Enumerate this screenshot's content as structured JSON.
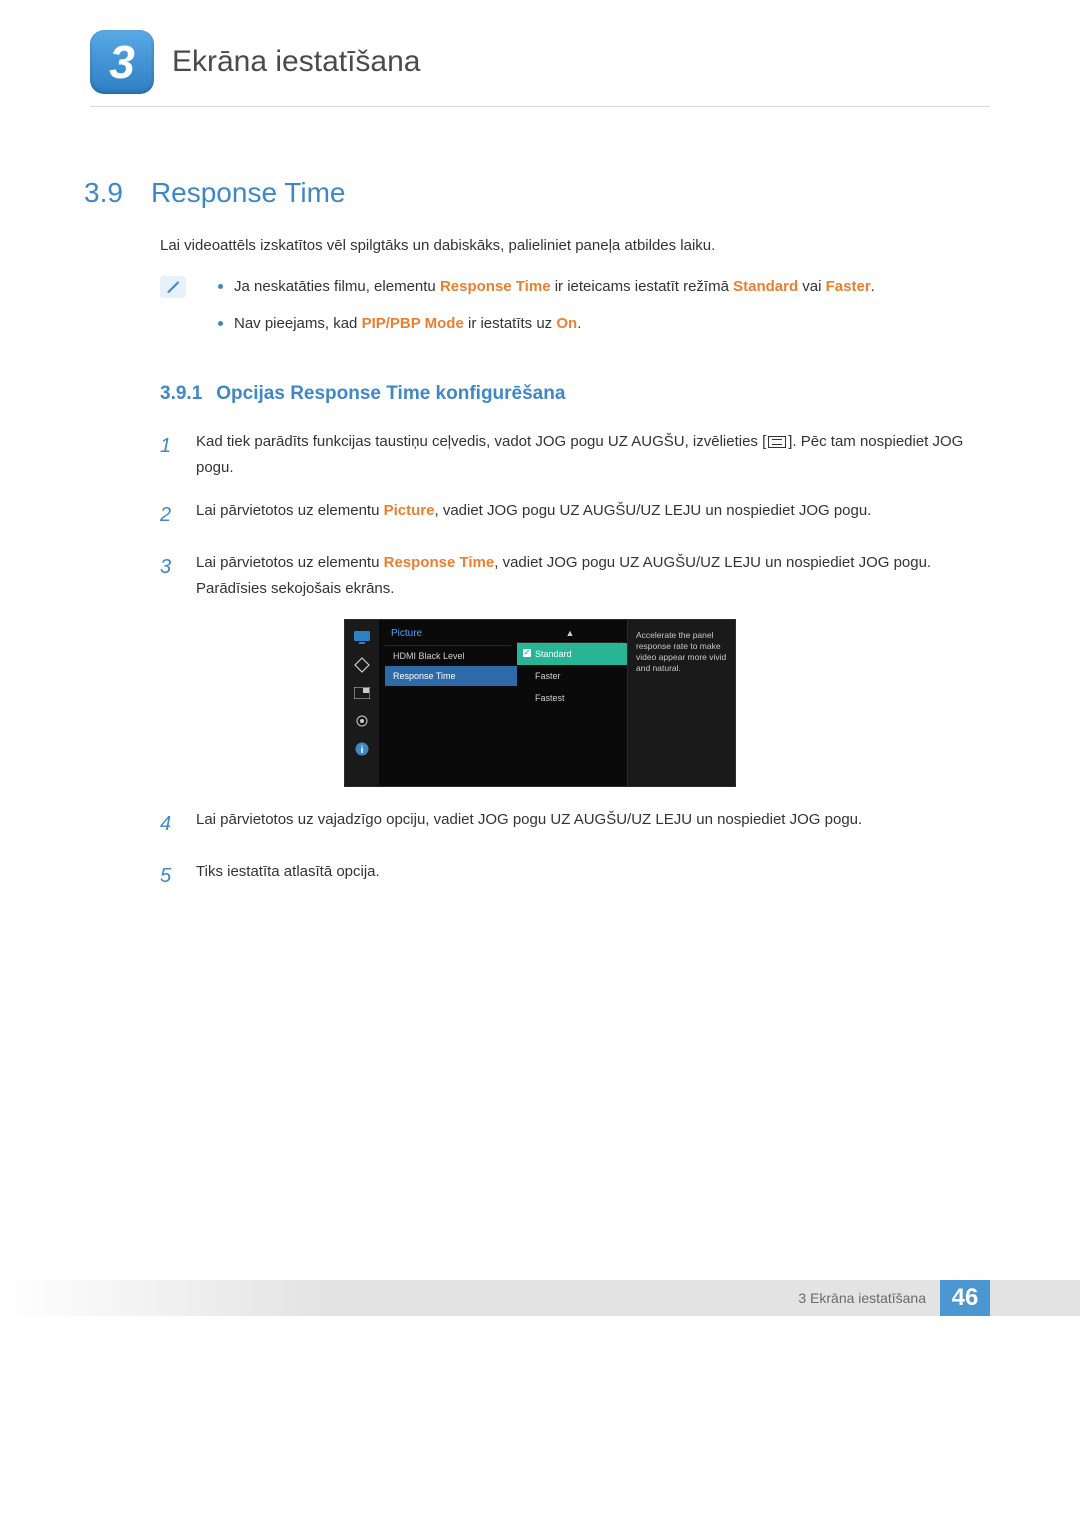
{
  "chapter": {
    "number": "3",
    "title": "Ekrāna iestatīšana"
  },
  "section": {
    "number": "3.9",
    "title": "Response Time"
  },
  "intro": "Lai videoattēls izskatītos vēl spilgtāks un dabiskāks, palieliniet paneļa atbildes laiku.",
  "notes": {
    "n1a": "Ja neskatāties filmu, elementu ",
    "n1_hl1": "Response Time",
    "n1b": " ir ieteicams iestatīt režīmā ",
    "n1_hl2": "Standard",
    "n1c": " vai ",
    "n1_hl3": "Faster",
    "n1d": ".",
    "n2a": "Nav pieejams, kad ",
    "n2_hl1": "PIP/PBP Mode",
    "n2b": " ir iestatīts uz ",
    "n2_hl2": "On",
    "n2c": "."
  },
  "subsection": {
    "number": "3.9.1",
    "title": "Opcijas Response Time konfigurēšana"
  },
  "steps": {
    "s1a": "Kad tiek parādīts funkcijas taustiņu ceļvedis, vadot JOG pogu UZ AUGŠU, izvēlieties [",
    "s1b": "]. Pēc tam nospiediet JOG pogu.",
    "s2a": "Lai pārvietotos uz elementu ",
    "s2_hl": "Picture",
    "s2b": ", vadiet JOG pogu UZ AUGŠU/UZ LEJU un nospiediet JOG pogu.",
    "s3a": "Lai pārvietotos uz elementu ",
    "s3_hl": "Response Time",
    "s3b": ", vadiet JOG pogu UZ AUGŠU/UZ LEJU un nospiediet JOG pogu. Parādīsies sekojošais ekrāns.",
    "s4": "Lai pārvietotos uz vajadzīgo opciju, vadiet JOG pogu UZ AUGŠU/UZ LEJU un nospiediet JOG pogu.",
    "s5": "Tiks iestatīta atlasītā opcija."
  },
  "osd": {
    "category": "Picture",
    "items": [
      "HDMI Black Level",
      "Response Time"
    ],
    "selected_item_index": 1,
    "options": [
      "Standard",
      "Faster",
      "Fastest"
    ],
    "selected_option_index": 0,
    "description": "Accelerate the panel response rate to make video appear more vivid and natural."
  },
  "footer": {
    "text": "3 Ekrāna iestatīšana",
    "page": "46"
  }
}
